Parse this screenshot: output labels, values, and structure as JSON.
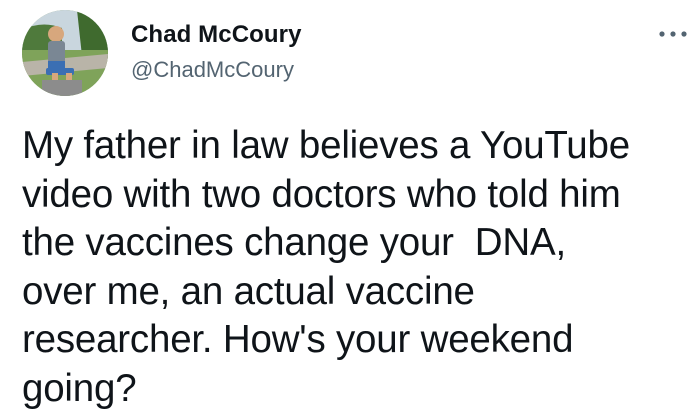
{
  "tweet": {
    "author": {
      "display_name": "Chad McCoury",
      "handle": "@ChadMcCoury",
      "avatar_icon": "profile-photo"
    },
    "more_icon": "more-horizontal-icon",
    "text": "My father in law believes a YouTube\nvideo with two doctors who told him\nthe vaccines change your  DNA,\nover me, an actual vaccine\nresearcher. How's your weekend\ngoing?"
  },
  "colors": {
    "text": "#0f1419",
    "secondary_text": "#536471",
    "background": "#ffffff"
  }
}
